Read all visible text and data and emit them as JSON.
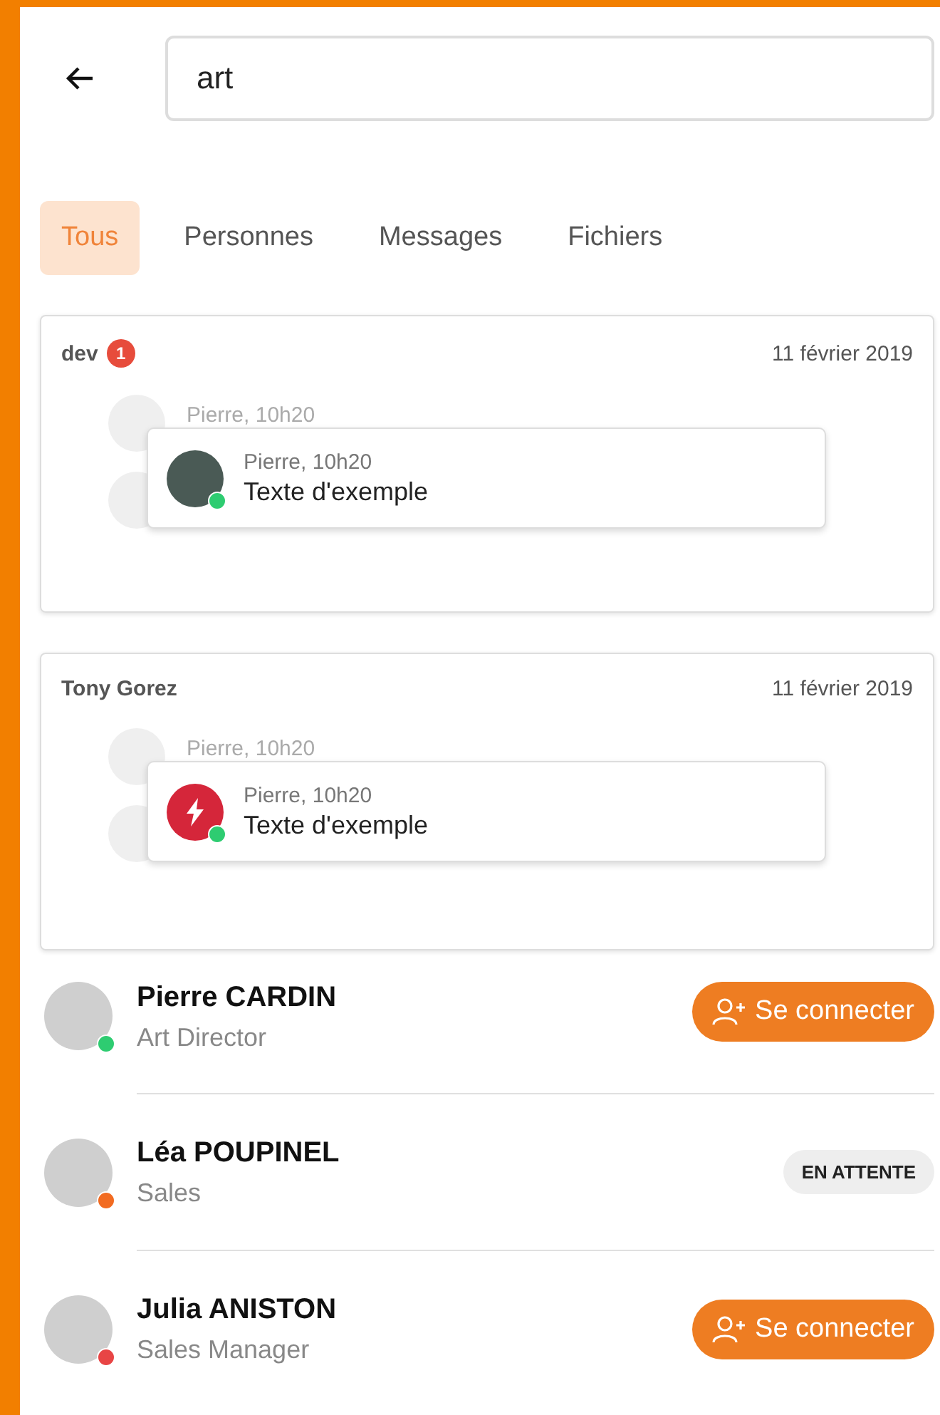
{
  "search": {
    "value": "art"
  },
  "tabs": [
    {
      "label": "Tous",
      "selected": true
    },
    {
      "label": "Personnes",
      "selected": false
    },
    {
      "label": "Messages",
      "selected": false
    },
    {
      "label": "Fichiers",
      "selected": false
    }
  ],
  "conversations": [
    {
      "title": "dev",
      "unread": "1",
      "date": "11 février 2019",
      "behind_meta": "Pierre, 10h20",
      "meta": "Pierre, 10h20",
      "text": "Texte d'exemple",
      "kind": "photo",
      "color": "#2ecc71"
    },
    {
      "title": "Tony Gorez",
      "date": "11 février 2019",
      "behind_meta": "Pierre, 10h20",
      "meta": "Pierre, 10h20",
      "text": "Texte d'exemple",
      "kind": "bolt",
      "color": "#2ecc71"
    }
  ],
  "people": [
    {
      "name": "Pierre CARDIN",
      "role": "Art Director",
      "color": "#2ecc71",
      "action": {
        "kind": "connect",
        "label": "Se connecter"
      }
    },
    {
      "name": "Léa POUPINEL",
      "role": "Sales",
      "color": "#f26b21",
      "action": {
        "kind": "pending",
        "label": "EN ATTENTE"
      }
    },
    {
      "name": "Julia ANISTON",
      "role": "Sales Manager",
      "color": "#e84545",
      "action": {
        "kind": "connect",
        "label": "Se connecter"
      }
    }
  ]
}
